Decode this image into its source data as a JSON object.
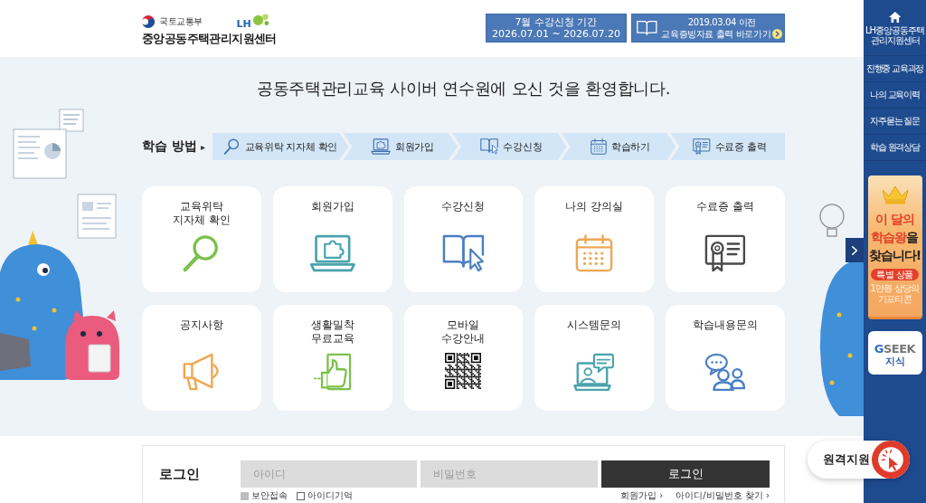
{
  "header": {
    "agency": "국토교통부",
    "partner_logo": "LH",
    "site_title": "중앙공동주택관리지원센터",
    "notices": [
      {
        "lines": [
          "7월 수강신청 기간",
          "2026.07.01 ~ 2026.07.20"
        ]
      },
      {
        "lines": [
          "2019.03.04 이전",
          "교육증빙자료 출력 바로가기"
        ]
      }
    ]
  },
  "welcome": "공동주택관리교육 사이버 연수원에 오신 것을 환영합니다.",
  "learning_steps": {
    "title": "학습 방법",
    "marker": "▸",
    "steps": [
      {
        "label": "교육위탁 지자체 확인"
      },
      {
        "label": "회원가입"
      },
      {
        "label": "수강신청"
      },
      {
        "label": "학습하기"
      },
      {
        "label": "수료증 출력"
      }
    ]
  },
  "menu_cards": [
    {
      "lines": [
        "교육위탁",
        "지자체 확인"
      ]
    },
    {
      "lines": [
        "회원가입"
      ]
    },
    {
      "lines": [
        "수강신청"
      ]
    },
    {
      "lines": [
        "나의 강의실"
      ]
    },
    {
      "lines": [
        "수료증 출력"
      ]
    },
    {
      "lines": [
        "공지사항"
      ]
    },
    {
      "lines": [
        "생활밀착",
        "무료교육"
      ]
    },
    {
      "lines": [
        "모바일",
        "수강안내"
      ]
    },
    {
      "lines": [
        "시스템문의"
      ]
    },
    {
      "lines": [
        "학습내용문의"
      ]
    }
  ],
  "login": {
    "title": "로그인",
    "fields": [
      {
        "placeholder": "아이디"
      },
      {
        "placeholder": "비밀번호"
      }
    ],
    "button": "로그인",
    "options": [
      {
        "label": "보안접속",
        "checked": true
      },
      {
        "label": "아이디기억",
        "checked": false
      }
    ],
    "links": [
      "회원가입 ›",
      "아이디/비밀번호 찾기 ›"
    ]
  },
  "remote_support": {
    "label": "원격지원"
  },
  "sidebar": {
    "home": {
      "lines": [
        "LH중앙공동주택",
        "관리지원센터"
      ]
    },
    "items": [
      {
        "label": "진행중 교육과정"
      },
      {
        "label": "나의 교육이력"
      },
      {
        "label": "자주묻는 질문"
      },
      {
        "label": "학습 원격상담"
      }
    ],
    "banner": {
      "headline": [
        [
          {
            "text": "이 달의",
            "accent": true
          }
        ],
        [
          {
            "text": "학습왕",
            "accent": true
          },
          {
            "text": "을",
            "accent": false
          }
        ],
        [
          {
            "text": "찾습니다!",
            "accent": false
          }
        ]
      ],
      "badge": "특별 상품",
      "note": [
        "1만원 상당의",
        "기프티콘"
      ]
    },
    "gseek": {
      "logo": "GSEEK",
      "caption": "지식"
    }
  }
}
